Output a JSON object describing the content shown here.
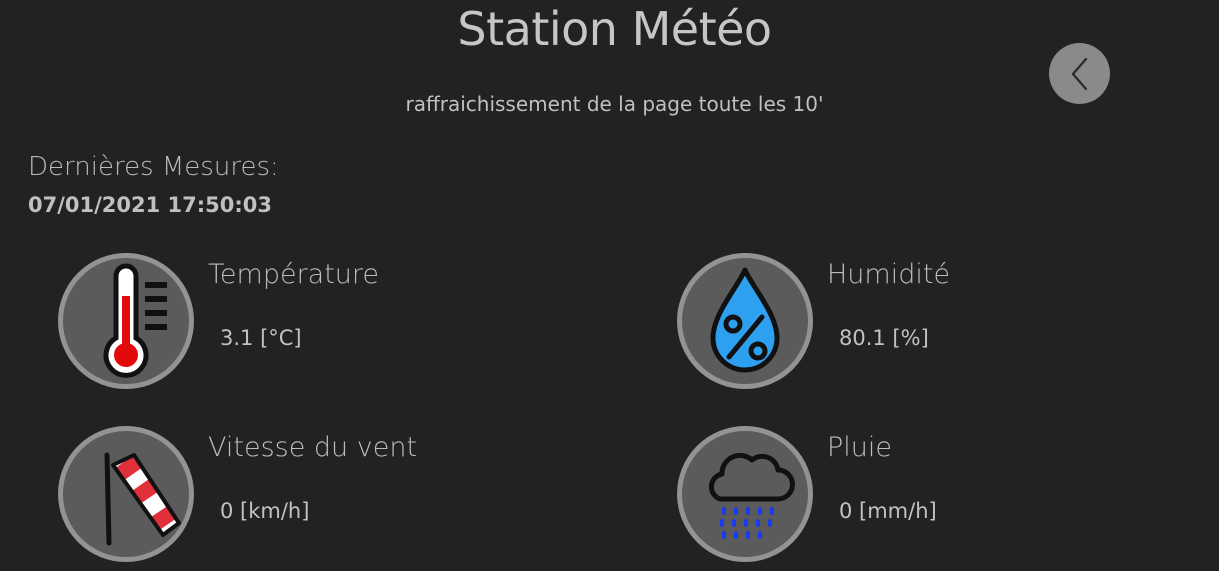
{
  "header": {
    "title": "Station Météo",
    "subtitle": "raffraichissement de la page toute les 10'"
  },
  "back_button": {
    "icon": "chevron-left-icon"
  },
  "measures": {
    "label": "Dernières Mesures:",
    "timestamp": "07/01/2021 17:50:03"
  },
  "metrics": [
    {
      "label": "Température",
      "value": "3.1 [°C]",
      "icon": "thermometer-icon"
    },
    {
      "label": "Humidité",
      "value": "80.1 [%]",
      "icon": "humidity-drop-icon"
    },
    {
      "label": "Vitesse du vent",
      "value": "0 [km/h]",
      "icon": "windsock-icon"
    },
    {
      "label": "Pluie",
      "value": "0 [mm/h]",
      "icon": "rain-cloud-icon"
    }
  ],
  "colors": {
    "background": "#222222",
    "thermometer_red": "#e20a0a",
    "drop_blue": "#2ea0f0",
    "rain_blue": "#1a3cf0",
    "windsock_red": "#e0303a"
  }
}
